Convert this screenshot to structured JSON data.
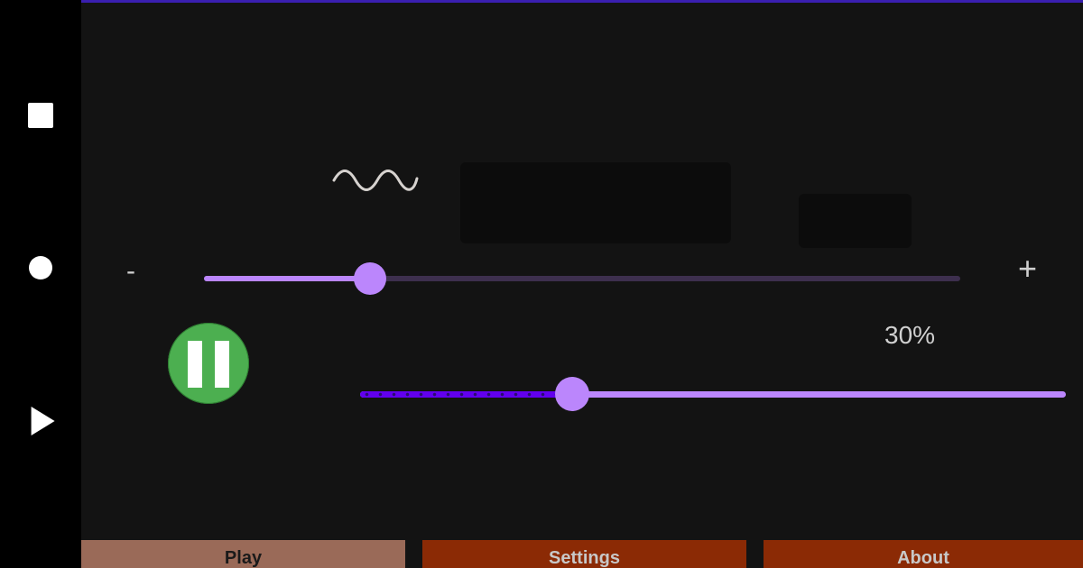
{
  "nav": {
    "items": [
      {
        "icon": "square-icon"
      },
      {
        "icon": "circle-icon"
      },
      {
        "icon": "triangle-play-icon"
      }
    ]
  },
  "player": {
    "waveform_icon": "sine-wave-icon",
    "volume": {
      "minus_label": "-",
      "plus_label": "+",
      "level": 0.22
    },
    "pause_icon": "pause-icon",
    "percent_label": "30%",
    "progress": {
      "value": 0.3
    }
  },
  "tabs": [
    {
      "label": "Play"
    },
    {
      "label": "Settings"
    },
    {
      "label": "About"
    }
  ],
  "colors": {
    "accent": "#bb86fc",
    "accent_dark": "#6200ee",
    "pause_button": "#4caf50",
    "tab_active": "#9a6a58",
    "tab_inactive": "#8b2a05",
    "background": "#131313"
  }
}
